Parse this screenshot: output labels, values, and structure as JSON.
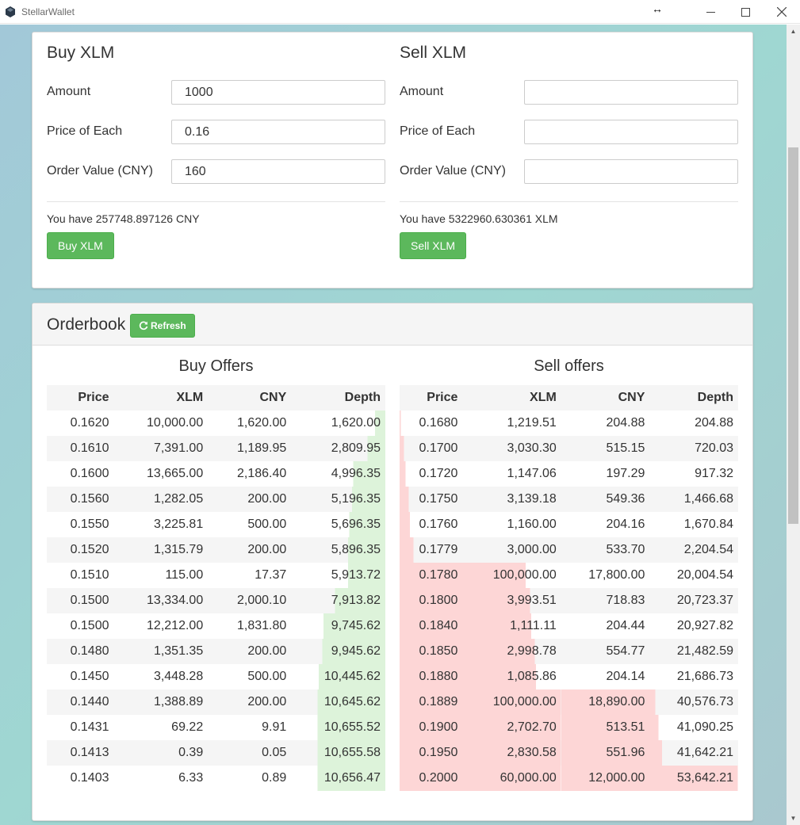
{
  "window": {
    "title": "StellarWallet"
  },
  "buy": {
    "title": "Buy XLM",
    "amount_label": "Amount",
    "amount_value": "1000",
    "price_label": "Price of Each",
    "price_value": "0.16",
    "order_label": "Order Value (CNY)",
    "order_value": "160",
    "balance": "You have 257748.897126 CNY",
    "button": "Buy XLM"
  },
  "sell": {
    "title": "Sell XLM",
    "amount_label": "Amount",
    "amount_value": "",
    "price_label": "Price of Each",
    "price_value": "",
    "order_label": "Order Value (CNY)",
    "order_value": "",
    "balance": "You have 5322960.630361 XLM",
    "button": "Sell XLM"
  },
  "orderbook": {
    "title": "Orderbook",
    "refresh_label": "Refresh",
    "buy_title": "Buy Offers",
    "sell_title": "Sell offers",
    "columns": [
      "Price",
      "XLM",
      "CNY",
      "Depth"
    ],
    "buy_rows": [
      [
        "0.1620",
        "10,000.00",
        "1,620.00",
        "1,620.00"
      ],
      [
        "0.1610",
        "7,391.00",
        "1,189.95",
        "2,809.95"
      ],
      [
        "0.1600",
        "13,665.00",
        "2,186.40",
        "4,996.35"
      ],
      [
        "0.1560",
        "1,282.05",
        "200.00",
        "5,196.35"
      ],
      [
        "0.1550",
        "3,225.81",
        "500.00",
        "5,696.35"
      ],
      [
        "0.1520",
        "1,315.79",
        "200.00",
        "5,896.35"
      ],
      [
        "0.1510",
        "115.00",
        "17.37",
        "5,913.72"
      ],
      [
        "0.1500",
        "13,334.00",
        "2,000.10",
        "7,913.82"
      ],
      [
        "0.1500",
        "12,212.00",
        "1,831.80",
        "9,745.62"
      ],
      [
        "0.1480",
        "1,351.35",
        "200.00",
        "9,945.62"
      ],
      [
        "0.1450",
        "3,448.28",
        "500.00",
        "10,445.62"
      ],
      [
        "0.1440",
        "1,388.89",
        "200.00",
        "10,645.62"
      ],
      [
        "0.1431",
        "69.22",
        "9.91",
        "10,655.52"
      ],
      [
        "0.1413",
        "0.39",
        "0.05",
        "10,655.58"
      ],
      [
        "0.1403",
        "6.33",
        "0.89",
        "10,656.47"
      ]
    ],
    "buy_depth_fractions": [
      0.15,
      0.26,
      0.47,
      0.49,
      0.53,
      0.55,
      0.55,
      0.74,
      0.91,
      0.93,
      0.98,
      1.0,
      1.0,
      1.0,
      1.0
    ],
    "sell_rows": [
      [
        "0.1680",
        "1,219.51",
        "204.88",
        "204.88"
      ],
      [
        "0.1700",
        "3,030.30",
        "515.15",
        "720.03"
      ],
      [
        "0.1720",
        "1,147.06",
        "197.29",
        "917.32"
      ],
      [
        "0.1750",
        "3,139.18",
        "549.36",
        "1,466.68"
      ],
      [
        "0.1760",
        "1,160.00",
        "204.16",
        "1,670.84"
      ],
      [
        "0.1779",
        "3,000.00",
        "533.70",
        "2,204.54"
      ],
      [
        "0.1780",
        "100,000.00",
        "17,800.00",
        "20,004.54"
      ],
      [
        "0.1800",
        "3,993.51",
        "718.83",
        "20,723.37"
      ],
      [
        "0.1840",
        "1,111.11",
        "204.44",
        "20,927.82"
      ],
      [
        "0.1850",
        "2,998.78",
        "554.77",
        "21,482.59"
      ],
      [
        "0.1880",
        "1,085.86",
        "204.14",
        "21,686.73"
      ],
      [
        "0.1889",
        "100,000.00",
        "18,890.00",
        "40,576.73"
      ],
      [
        "0.1900",
        "2,702.70",
        "513.51",
        "41,090.25"
      ],
      [
        "0.1950",
        "2,830.58",
        "551.96",
        "41,642.21"
      ],
      [
        "0.2000",
        "60,000.00",
        "12,000.00",
        "53,642.21"
      ]
    ],
    "sell_depth_fractions": [
      0.004,
      0.013,
      0.017,
      0.027,
      0.031,
      0.041,
      0.373,
      0.386,
      0.39,
      0.4,
      0.404,
      0.756,
      0.766,
      0.776,
      1.0
    ]
  }
}
